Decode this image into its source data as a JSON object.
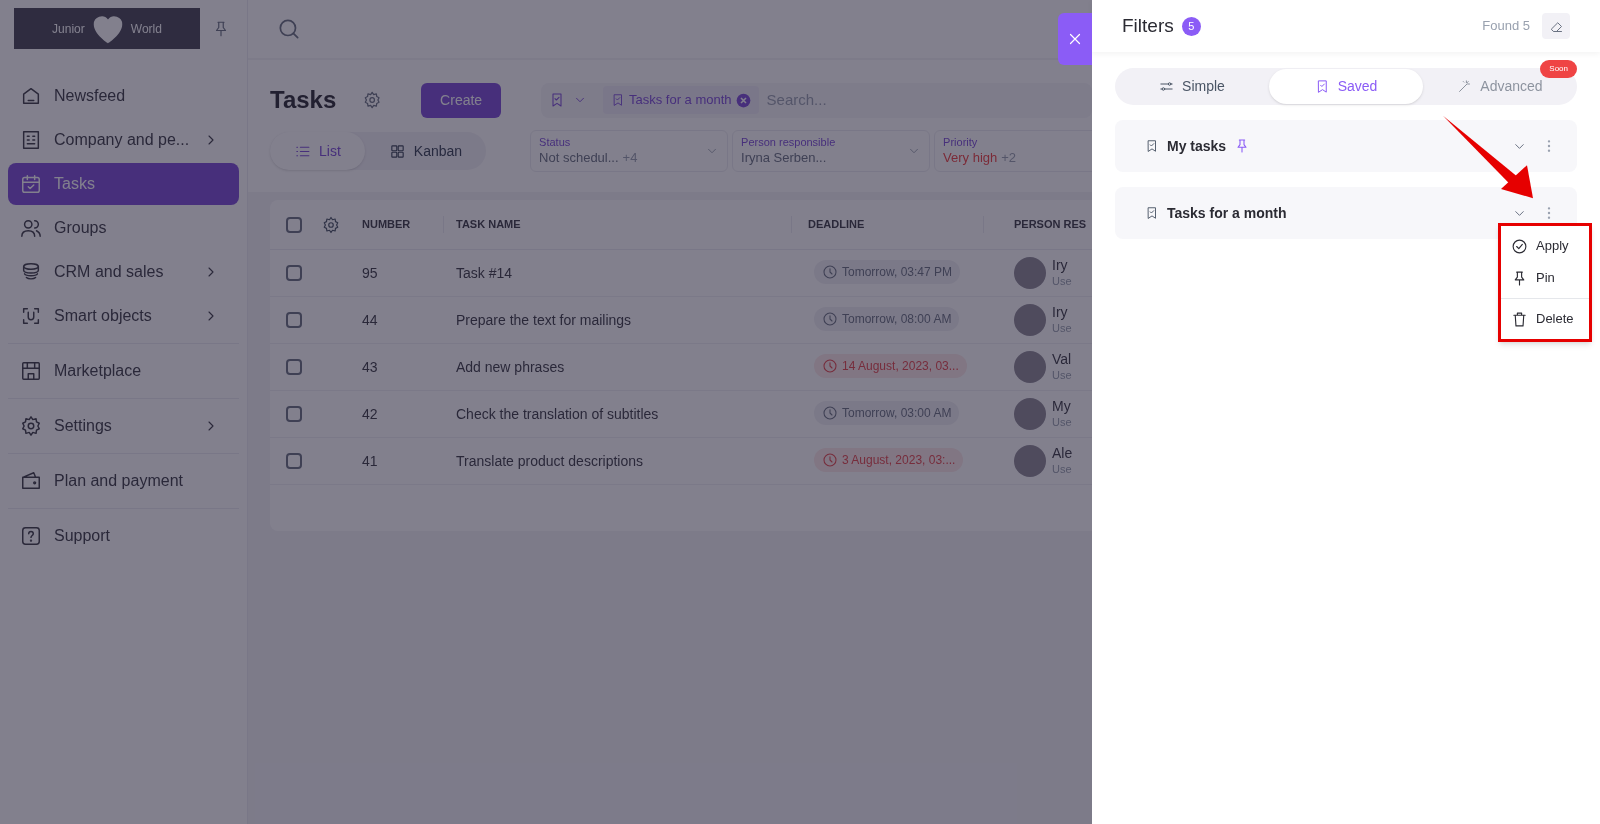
{
  "sidebar": {
    "logo": {
      "left": "Junior",
      "right": "World"
    },
    "sections": [
      [
        {
          "label": "Newsfeed",
          "selected": false,
          "submenu": false
        },
        {
          "label": "Company and pe...",
          "selected": false,
          "submenu": true
        },
        {
          "label": "Tasks",
          "selected": true,
          "submenu": false
        },
        {
          "label": "Groups",
          "selected": false,
          "submenu": false
        },
        {
          "label": "CRM and sales",
          "selected": false,
          "submenu": true
        },
        {
          "label": "Smart objects",
          "selected": false,
          "submenu": true
        }
      ],
      [
        {
          "label": "Marketplace",
          "selected": false,
          "submenu": false
        }
      ],
      [
        {
          "label": "Settings",
          "selected": false,
          "submenu": true
        }
      ],
      [
        {
          "label": "Plan and payment",
          "selected": false,
          "submenu": false
        }
      ],
      [
        {
          "label": "Support",
          "selected": false,
          "submenu": false
        }
      ]
    ]
  },
  "main": {
    "title": "Tasks",
    "create": "Create",
    "views": [
      {
        "label": "List",
        "selected": true
      },
      {
        "label": "Kanban",
        "selected": false
      }
    ],
    "search": {
      "chip": "Tasks for a month",
      "placeholder": "Search..."
    },
    "filters": [
      {
        "label": "Status",
        "value": "Not schedul...",
        "extra": "+4",
        "alert": false
      },
      {
        "label": "Person responsible",
        "value": "Iryna Serben...",
        "alert": false
      },
      {
        "label": "Priority",
        "value": "Very high",
        "extra": "+2",
        "alert": true
      }
    ],
    "table": {
      "all_checked": false,
      "columns": [
        "NUMBER",
        "TASK NAME",
        "DEADLINE",
        "PERSON RES"
      ],
      "rows": [
        {
          "checked": false,
          "number": "95",
          "name": "Task #14",
          "deadline": "Tomorrow, 03:47 PM",
          "overdue": false,
          "person": "Iry",
          "role": "Use"
        },
        {
          "checked": false,
          "number": "44",
          "name": "Prepare the text for mailings",
          "deadline": "Tomorrow, 08:00 AM",
          "overdue": false,
          "person": "Iry",
          "role": "Use"
        },
        {
          "checked": false,
          "number": "43",
          "name": "Add new phrases",
          "deadline": "14 August, 2023, 03...",
          "overdue": true,
          "person": "Val",
          "role": "Use"
        },
        {
          "checked": false,
          "number": "42",
          "name": "Check the translation of subtitles",
          "deadline": "Tomorrow, 03:00 AM",
          "overdue": false,
          "person": "My",
          "role": "Use"
        },
        {
          "checked": false,
          "number": "41",
          "name": "Translate product descriptions",
          "deadline": "3 August, 2023, 03:...",
          "overdue": true,
          "person": "Ale",
          "role": "Use"
        }
      ]
    }
  },
  "drawer": {
    "title": "Filters",
    "count": "5",
    "found": "Found 5",
    "tabs": [
      {
        "label": "Simple",
        "selected": false,
        "disabled": false
      },
      {
        "label": "Saved",
        "selected": true,
        "disabled": false
      },
      {
        "label": "Advanced",
        "selected": false,
        "disabled": true,
        "badge": "Soon"
      }
    ],
    "saved": [
      {
        "name": "My tasks",
        "pinned": true,
        "menu_open": false
      },
      {
        "name": "Tasks for a month",
        "pinned": false,
        "menu_open": true
      }
    ],
    "menu": [
      [
        {
          "label": "Apply"
        },
        {
          "label": "Pin"
        }
      ],
      [
        {
          "label": "Delete"
        }
      ]
    ]
  }
}
